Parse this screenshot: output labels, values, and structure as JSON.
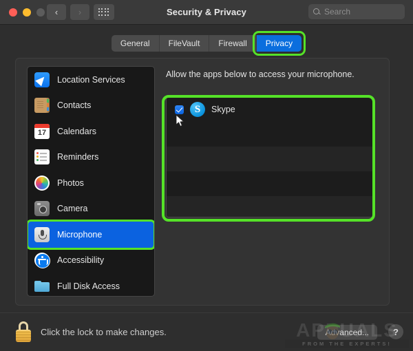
{
  "window": {
    "title": "Security & Privacy",
    "traffic_lights": [
      {
        "name": "close",
        "color": "#ff5f57"
      },
      {
        "name": "minimize",
        "color": "#febc2e"
      },
      {
        "name": "zoom",
        "color": "#5c5c5c"
      }
    ],
    "nav": {
      "back": "‹",
      "forward": "›",
      "grid": "grid-icon"
    },
    "search": {
      "placeholder": "Search",
      "value": ""
    }
  },
  "tabs": [
    {
      "label": "General",
      "active": false
    },
    {
      "label": "FileVault",
      "active": false
    },
    {
      "label": "Firewall",
      "active": false
    },
    {
      "label": "Privacy",
      "active": true,
      "highlighted": true
    }
  ],
  "sidebar": {
    "items": [
      {
        "label": "Location Services",
        "icon": "location-services-icon",
        "selected": false
      },
      {
        "label": "Contacts",
        "icon": "contacts-icon",
        "selected": false
      },
      {
        "label": "Calendars",
        "icon": "calendars-icon",
        "selected": false,
        "day": "17"
      },
      {
        "label": "Reminders",
        "icon": "reminders-icon",
        "selected": false
      },
      {
        "label": "Photos",
        "icon": "photos-icon",
        "selected": false
      },
      {
        "label": "Camera",
        "icon": "camera-icon",
        "selected": false
      },
      {
        "label": "Microphone",
        "icon": "microphone-icon",
        "selected": true,
        "highlighted": true
      },
      {
        "label": "Accessibility",
        "icon": "accessibility-icon",
        "selected": false
      },
      {
        "label": "Full Disk Access",
        "icon": "folder-icon",
        "selected": false
      }
    ]
  },
  "main": {
    "instruction": "Allow the apps below to access your microphone.",
    "apps": [
      {
        "name": "Skype",
        "checked": true,
        "icon": "skype-icon",
        "glyph": "S"
      }
    ],
    "list_highlighted": true
  },
  "bottom": {
    "lock_icon": "lock-closed-icon",
    "lock_text": "Click the lock to make changes.",
    "advanced_label": "Advanced...",
    "help_label": "?"
  },
  "watermark": {
    "brand": "APPUALS",
    "tagline": "FROM THE EXPERTS!"
  },
  "colors": {
    "accent_blue": "#0a6ede",
    "highlight_green": "#55e228",
    "window_bg": "#2e2e2e",
    "panel_bg": "#333333",
    "list_bg": "#181818"
  }
}
